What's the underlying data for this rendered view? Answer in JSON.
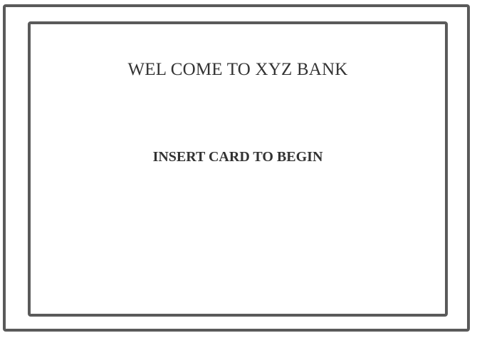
{
  "screen": {
    "title": "WEL COME TO XYZ BANK",
    "prompt": "INSERT CARD TO BEGIN"
  },
  "colors": {
    "frame": "#5a5a5a",
    "text": "#333333",
    "background": "#ffffff"
  }
}
